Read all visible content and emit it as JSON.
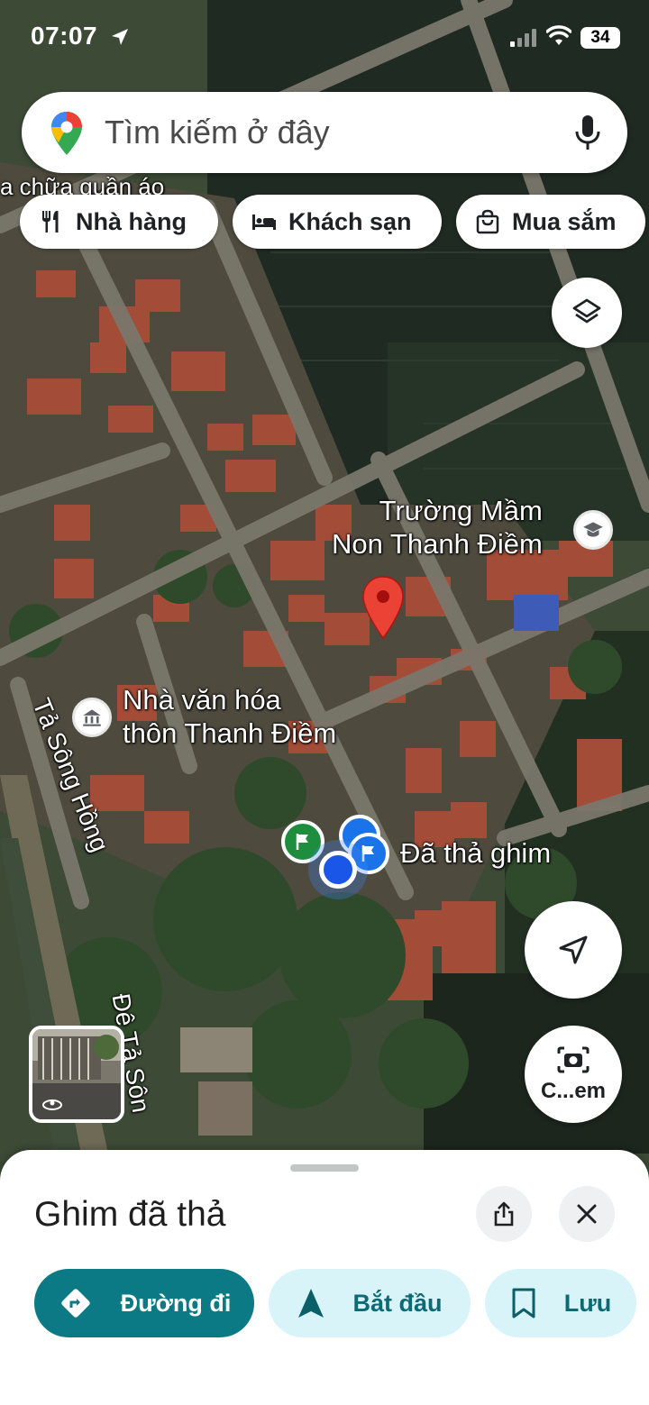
{
  "status_bar": {
    "time": "07:07",
    "battery": "34"
  },
  "search": {
    "placeholder": "Tìm kiếm ở đây"
  },
  "chips": [
    {
      "label": "Nhà hàng",
      "icon": "restaurant-icon"
    },
    {
      "label": "Khách sạn",
      "icon": "hotel-icon"
    },
    {
      "label": "Mua sắm",
      "icon": "shopping-bag-icon"
    }
  ],
  "map": {
    "labels": {
      "partial_top": "a chữa quần áo",
      "school": "Trường Mầm\nNon Thanh Điềm",
      "culture_house": "Nhà văn hóa\nthôn Thanh Điềm",
      "dropped_pin": "Đã thả ghim",
      "road_1": "Tả Sông Hồng",
      "road_2": "Đê Tả Sôn"
    }
  },
  "buttons": {
    "camera_label": "C...em"
  },
  "sheet": {
    "title": "Ghim đã thả",
    "actions": {
      "directions": "Đường đi",
      "start": "Bắt đầu",
      "save": "Lưu"
    }
  },
  "colors": {
    "primary_teal": "#0b7a84",
    "tonal_bg": "#d9f4f8",
    "pin_red": "#ea4335",
    "user_blue": "#1a57e8",
    "flag_green": "#1e8e3e"
  }
}
